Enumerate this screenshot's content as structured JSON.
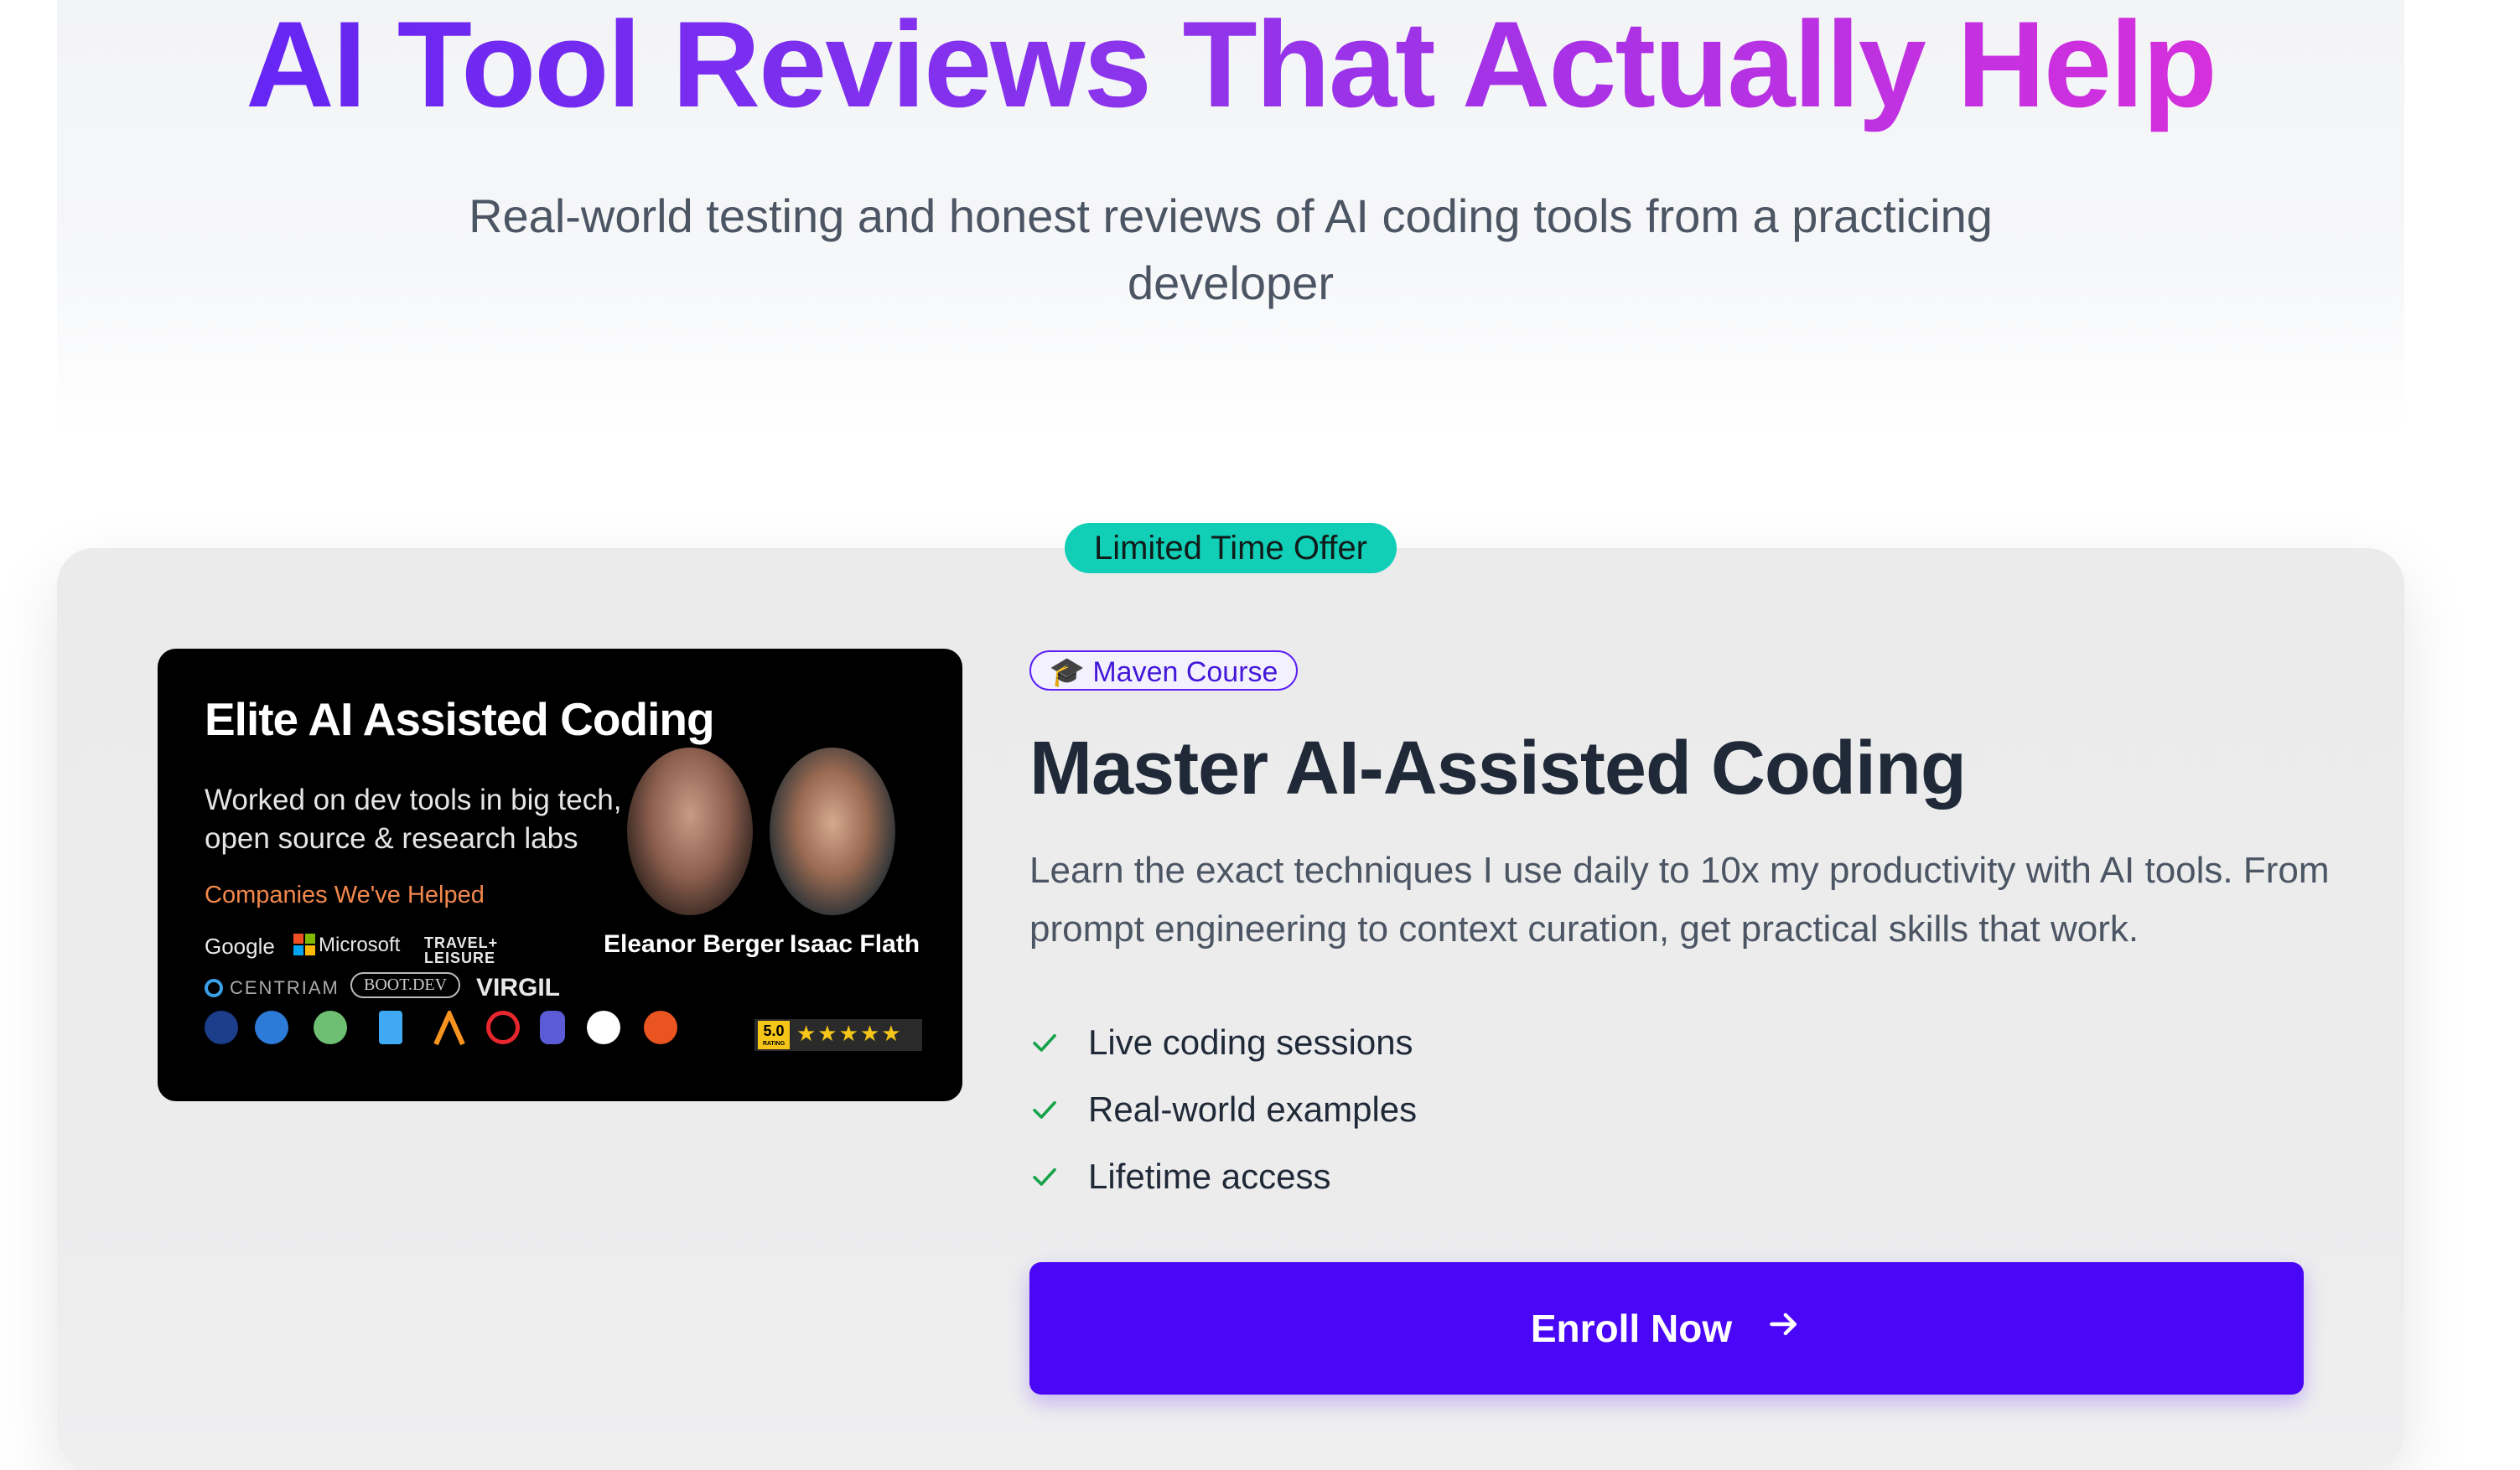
{
  "hero": {
    "title": "AI Tool Reviews That Actually Help",
    "subtitle": "Real-world testing and honest reviews of AI coding tools from a practicing developer"
  },
  "offer": {
    "badge": "Limited Time Offer",
    "badge_color": "#11cfb6"
  },
  "course_image": {
    "title": "Elite AI Assisted Coding",
    "description": "Worked on dev tools in big tech,\nopen source & research labs",
    "companies_label": "Companies We've Helped",
    "logos": [
      "Google",
      "Microsoft",
      "TRAVEL+ LEISURE",
      "CENTRIAM",
      "BOOT.DEV",
      "VIRGIL"
    ],
    "instructors": [
      "Eleanor Berger",
      "Isaac Flath"
    ],
    "rating": "5.0",
    "rating_caption": "RATING",
    "stars": "★★★★★"
  },
  "course": {
    "platform_label": "Maven Course",
    "platform_icon": "graduation-cap-icon",
    "title": "Master AI-Assisted Coding",
    "description": "Learn the exact techniques I use daily to 10x my productivity with AI tools. From prompt engineering to context curation, get practical skills that work.",
    "features": [
      "Live coding sessions",
      "Real-world examples",
      "Lifetime access"
    ],
    "cta_label": "Enroll Now",
    "cta_color": "#4a07f7",
    "check_color": "#16a34a"
  }
}
